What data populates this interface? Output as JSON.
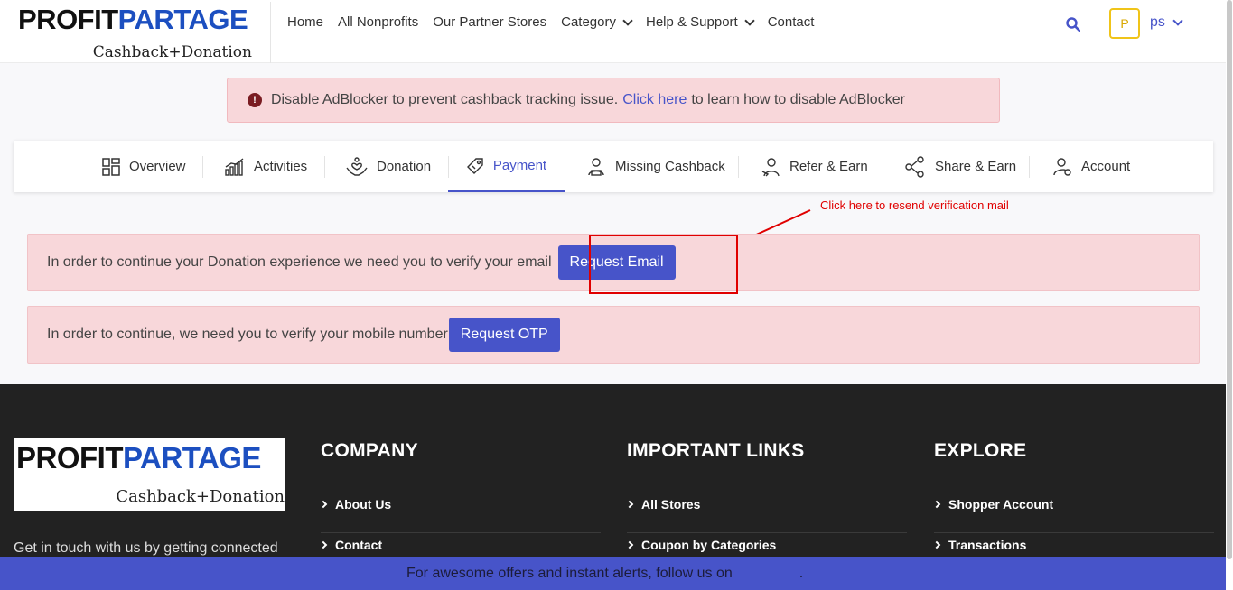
{
  "brand": {
    "logo_part1": "PROFIT",
    "logo_part2": "PARTAGE",
    "tagline": "Cashback+Donation"
  },
  "nav": {
    "home": "Home",
    "nonprofits": "All Nonprofits",
    "stores": "Our Partner Stores",
    "category": "Category",
    "help": "Help & Support",
    "contact": "Contact"
  },
  "user": {
    "avatar_letter": "P",
    "name": "ps"
  },
  "adblock": {
    "text_before": "Disable AdBlocker to prevent cashback tracking issue.",
    "link": "Click here",
    "text_after": "to learn how to disable AdBlocker"
  },
  "tabs": [
    "Overview",
    "Activities",
    "Donation",
    "Payment",
    "Missing Cashback",
    "Refer & Earn",
    "Share & Earn",
    "Account"
  ],
  "annotation": {
    "text": "Click here to resend verification mail",
    "color": "#e00000"
  },
  "alerts": {
    "email_text": "In order to continue your Donation experience we need you to verify your email",
    "email_button": "Request Email",
    "mobile_text": "In order to continue, we need you to verify your mobile number",
    "mobile_button": "Request OTP"
  },
  "footer": {
    "tagline": "Get in touch with us by getting connected",
    "company": {
      "title": "COMPANY",
      "links": [
        "About Us",
        "Contact"
      ]
    },
    "important": {
      "title": "IMPORTANT LINKS",
      "links": [
        "All Stores",
        "Coupon by Categories"
      ]
    },
    "explore": {
      "title": "EXPLORE",
      "links": [
        "Shopper Account",
        "Transactions"
      ]
    }
  },
  "bottom_bar": {
    "text": "For awesome offers and instant alerts, follow us on",
    "end": "."
  },
  "colors": {
    "accent": "#4754c9",
    "alert_bg": "#f8d7da",
    "footer_bg": "#222222",
    "brand_blue": "#1c4fc0"
  }
}
